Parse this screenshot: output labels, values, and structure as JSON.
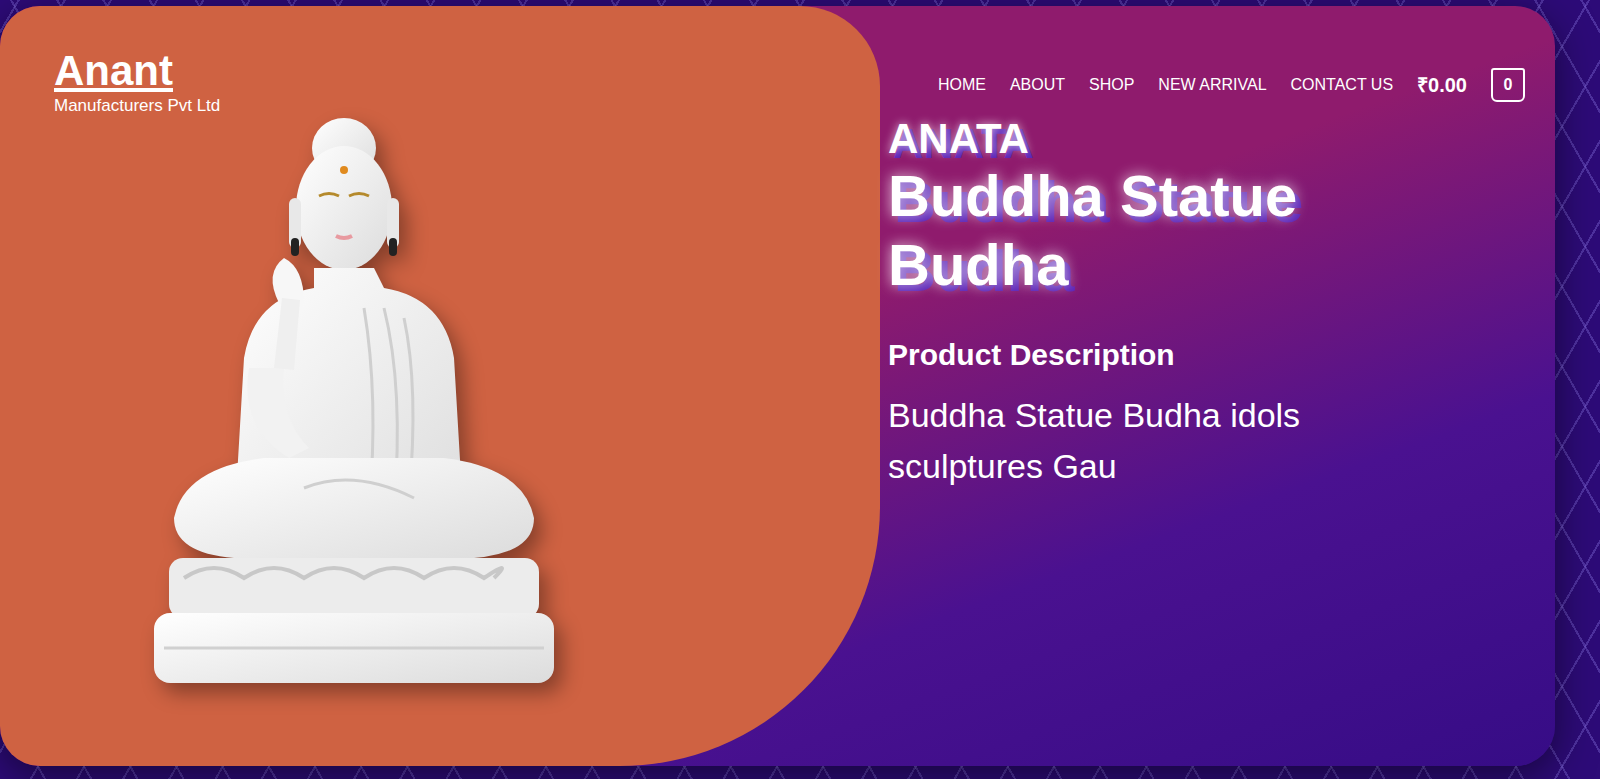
{
  "brand": {
    "name": "Anant",
    "tagline": "Manufacturers Pvt Ltd"
  },
  "nav": [
    "HOME",
    "ABOUT",
    "SHOP",
    "NEW ARRIVAL",
    "CONTACT US"
  ],
  "cart": {
    "total": "₹0.00",
    "count": "0"
  },
  "product": {
    "brand": "ANATA",
    "title": "Buddha Statue Budha",
    "description_heading": "Product Description",
    "description": "Buddha Statue Budha idols sculptures Gau"
  }
}
